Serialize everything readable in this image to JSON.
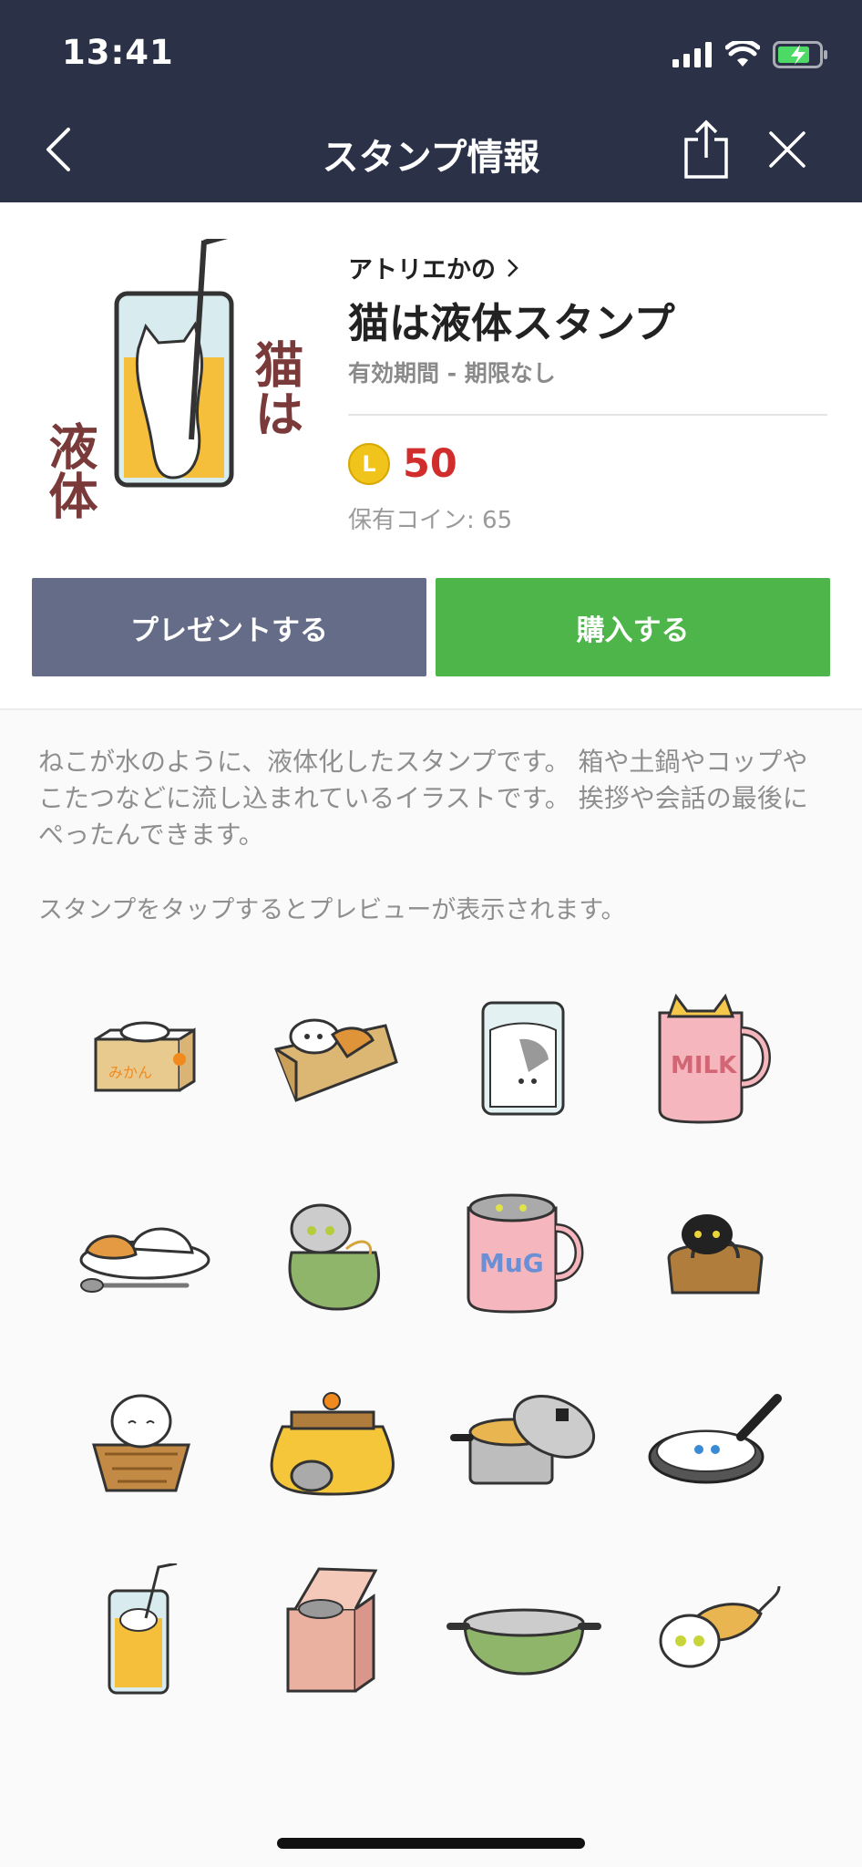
{
  "status": {
    "time": "13:41"
  },
  "nav": {
    "title": "スタンプ情報"
  },
  "product": {
    "author": "アトリエかの",
    "title": "猫は液体スタンプ",
    "validity": "有効期間 - 期限なし",
    "coin_symbol": "L",
    "price": "50",
    "owned_coins": "保有コイン: 65",
    "logo_text_1": "猫は",
    "logo_text_2": "液体"
  },
  "actions": {
    "gift_label": "プレゼントする",
    "buy_label": "購入する"
  },
  "description": {
    "text": "ねこが水のように、液体化したスタンプです。 箱や土鍋やコップやこたつなどに流し込まれているイラストです。 挨拶や会話の最後にぺったんできます。",
    "hint": "スタンプをタップするとプレビューが表示されます。"
  },
  "sticker_labels": {
    "box_text": "みかん",
    "milk_text": "MILK",
    "mug_text": "MuG"
  },
  "stickers": [
    "cat-in-mikan-box",
    "cat-in-cardboard-box",
    "cat-in-glass",
    "cat-in-milk-mug",
    "cat-on-curry-rice",
    "cat-in-furoshiki-bag",
    "cat-in-mug",
    "cat-in-handbag",
    "cat-in-basket",
    "cat-under-kotatsu",
    "cat-in-pot",
    "cat-in-frying-pan",
    "cat-in-juice-glass",
    "cat-in-pink-box",
    "cat-in-green-pot",
    "cat-falling"
  ],
  "colors": {
    "header_bg": "#2b3147",
    "gift_btn": "#646c87",
    "buy_btn": "#4db549",
    "price": "#d22d2d",
    "coin": "#f0c41b"
  }
}
